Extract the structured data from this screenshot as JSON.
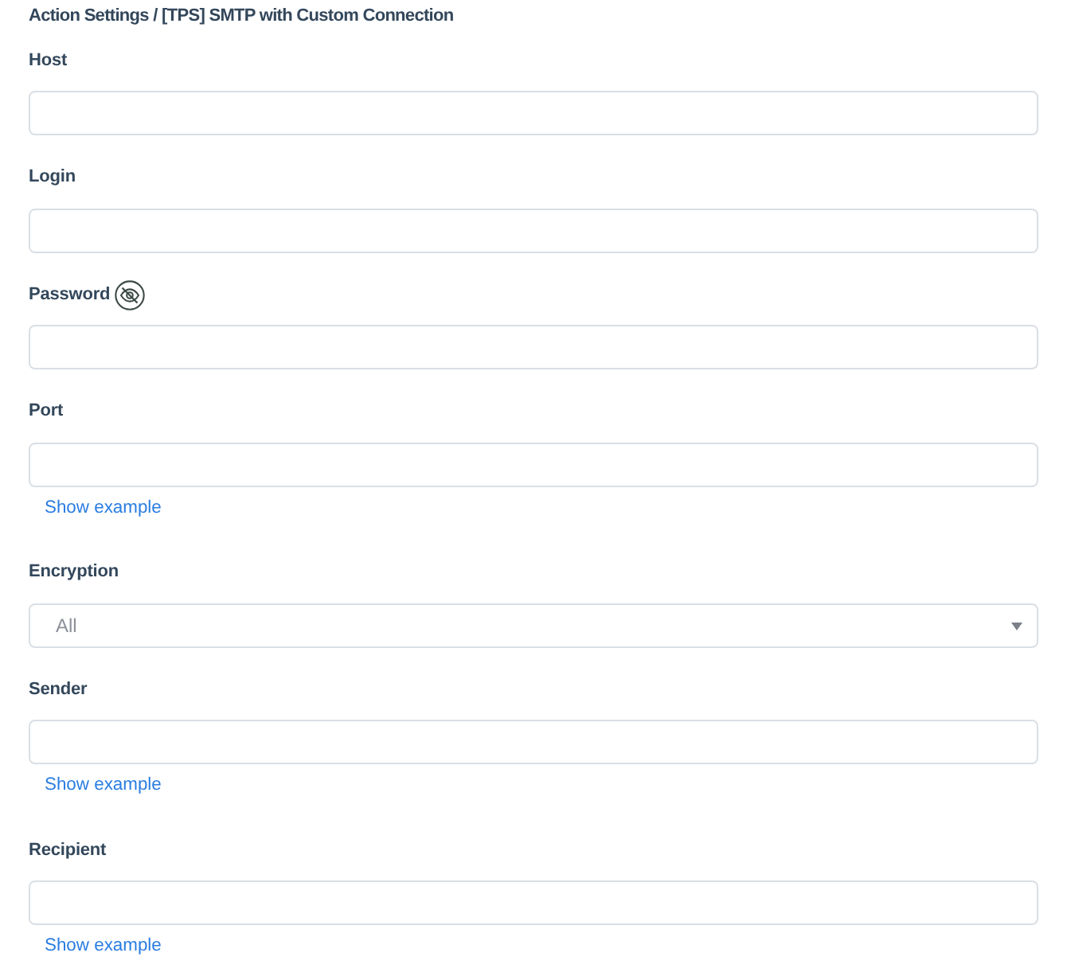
{
  "title": "Action Settings / [TPS] SMTP with Custom Connection",
  "fields": [
    {
      "kind": "text",
      "label": "Host"
    },
    {
      "kind": "text",
      "label": "Login"
    },
    {
      "kind": "password",
      "label": "Password"
    },
    {
      "kind": "text",
      "label": "Port",
      "example_link": "Show example"
    },
    {
      "kind": "select",
      "label": "Encryption",
      "value": "All"
    },
    {
      "kind": "text",
      "label": "Sender",
      "example_link": "Show example"
    },
    {
      "kind": "text",
      "label": "Recipient",
      "example_link": "Show example"
    }
  ]
}
